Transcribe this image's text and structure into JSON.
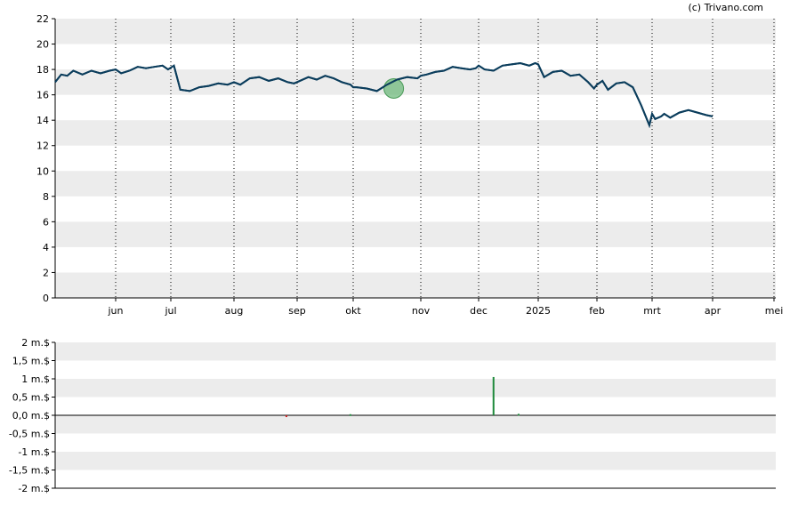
{
  "credit": "(c) Trivano.com",
  "chart_data": [
    {
      "type": "line",
      "ylim": [
        0,
        22
      ],
      "y_ticks": [
        0,
        2,
        4,
        6,
        8,
        10,
        12,
        14,
        16,
        18,
        20,
        22
      ],
      "x_tick_labels": [
        "jun",
        "jul",
        "aug",
        "sep",
        "okt",
        "nov",
        "dec",
        "2025",
        "feb",
        "mrt",
        "apr",
        "mei"
      ],
      "grid": "horizontal bands + dotted monthly verticals",
      "line_color": "#0b3d5c",
      "marker": {
        "month_index": 5.6,
        "value": 16.5,
        "color": "#6fba7c"
      },
      "series": [
        {
          "x": [
            0,
            0.1,
            0.2,
            0.3,
            0.45,
            0.6,
            0.75,
            0.9,
            1.0,
            1.1,
            1.25,
            1.4,
            1.55,
            1.7,
            1.85,
            1.95,
            2.05,
            2.15,
            2.3,
            2.45,
            2.6,
            2.75,
            2.9,
            3.0,
            3.1,
            3.25,
            3.4,
            3.55,
            3.7,
            3.85,
            3.95,
            4.05,
            4.2,
            4.35,
            4.5,
            4.65,
            4.8,
            4.95,
            5.0,
            5.05,
            5.2,
            5.35,
            5.5,
            5.65,
            5.8,
            5.95,
            6.0,
            6.1,
            6.25,
            6.4,
            6.55,
            6.7,
            6.85,
            6.95,
            7.0,
            7.1,
            7.25,
            7.4,
            7.55,
            7.7,
            7.85,
            7.95,
            8.0,
            8.1,
            8.25,
            8.4,
            8.55,
            8.7,
            8.85,
            8.95,
            9.0,
            9.1,
            9.2,
            9.35,
            9.5,
            9.65,
            9.8,
            9.95,
            10.0,
            10.05,
            10.15,
            10.2,
            10.3,
            10.45,
            10.6,
            10.75,
            10.9,
            11.0
          ],
          "values": [
            17.0,
            17.6,
            17.5,
            17.9,
            17.6,
            17.9,
            17.7,
            17.9,
            18.0,
            17.7,
            17.9,
            18.2,
            18.1,
            18.2,
            18.3,
            18.0,
            18.3,
            16.4,
            16.3,
            16.6,
            16.7,
            16.9,
            16.8,
            17.0,
            16.8,
            17.3,
            17.4,
            17.1,
            17.3,
            17.0,
            16.9,
            17.1,
            17.4,
            17.2,
            17.5,
            17.3,
            17.0,
            16.8,
            16.6,
            16.6,
            16.5,
            16.3,
            16.8,
            17.2,
            17.4,
            17.3,
            17.5,
            17.6,
            17.8,
            17.9,
            18.2,
            18.1,
            18.0,
            18.1,
            18.3,
            18.0,
            17.9,
            18.3,
            18.4,
            18.5,
            18.3,
            18.5,
            18.4,
            17.4,
            17.8,
            17.9,
            17.5,
            17.6,
            17.0,
            16.5,
            16.8,
            17.1,
            16.4,
            16.9,
            17.0,
            16.6,
            15.2,
            13.6,
            14.5,
            14.1,
            14.3,
            14.5,
            14.2,
            14.6,
            14.8,
            14.6,
            14.4,
            14.3
          ]
        }
      ]
    },
    {
      "type": "bar",
      "ylim": [
        -2,
        2
      ],
      "y_tick_labels": [
        "2 m.$",
        "1,5 m.$",
        "1 m.$",
        "0,5 m.$",
        "0,0 m.$",
        "-0,5 m.$",
        "-1 m.$",
        "-1,5 m.$",
        "-2 m.$"
      ],
      "y_tick_values": [
        2,
        1.5,
        1,
        0.5,
        0,
        -0.5,
        -1,
        -1.5,
        -2
      ],
      "positive_color": "#1f8a3b",
      "negative_color": "#cc2222",
      "series": [
        {
          "x": [
            2.83,
            3.95,
            6.25,
            6.67
          ],
          "values": [
            -0.05,
            0.03,
            1.05,
            0.04
          ]
        }
      ]
    }
  ]
}
